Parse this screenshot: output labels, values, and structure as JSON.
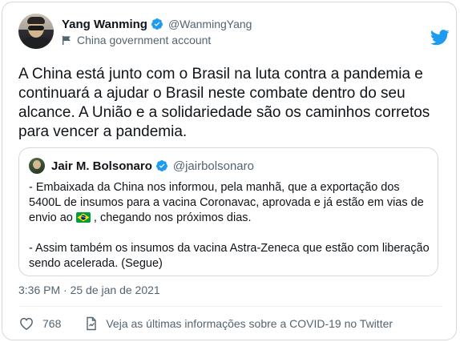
{
  "author": {
    "name": "Yang Wanming",
    "handle": "@WanmingYang",
    "label": "China government account"
  },
  "tweet": {
    "text": "A China está junto com o Brasil na luta contra a pandemia e continuará a ajudar o Brasil neste combate dentro do seu alcance. A União e a solidariedade são os caminhos corretos para vencer a pandemia."
  },
  "quote": {
    "name": "Jair M. Bolsonaro",
    "handle": "@jairbolsonaro",
    "line1": "- Embaixada da China nos informou, pela manhã, que a exportação dos 5400L de insumos para a vacina Coronavac, aprovada e já estão em vias de envio ao",
    "line1_end": ", chegando nos próximos dias.",
    "line2": "- Assim também os insumos da vacina Astra-Zeneca que estão com liberação sendo acelerada. (Segue)"
  },
  "timestamp": "3:36 PM · 25 de jan de 2021",
  "actions": {
    "like_count": "768",
    "covid_link": "Veja as últimas informações sobre a COVID-19 no Twitter"
  },
  "colors": {
    "twitter_blue": "#1d9bf0",
    "text_secondary": "#536471",
    "border": "#cfd9de"
  },
  "icons": [
    "verified-badge-icon",
    "flag-icon",
    "twitter-bird-icon",
    "heart-icon",
    "info-icon",
    "brazil-flag-emoji"
  ]
}
